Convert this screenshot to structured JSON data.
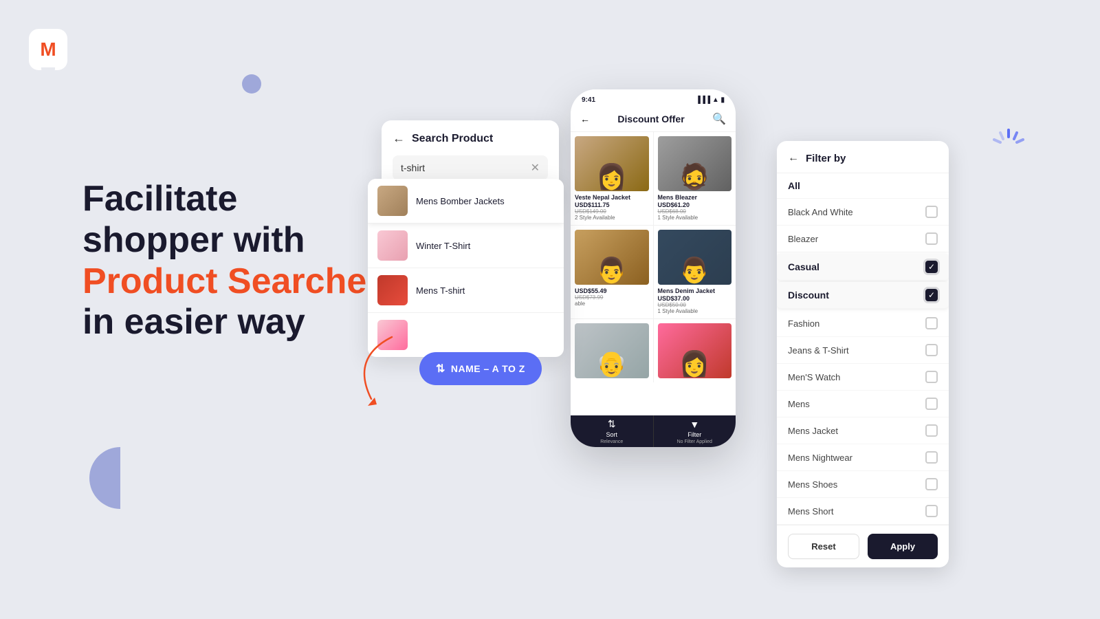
{
  "logo": {
    "letter": "M"
  },
  "hero": {
    "line1": "Facilitate",
    "line2": "shopper with",
    "highlight": "Product Searches",
    "line3": "in easier way"
  },
  "sort_badge": {
    "label": "NAME – A TO Z"
  },
  "search_panel": {
    "back_icon": "←",
    "title": "Search Product",
    "input_value": "t-shirt",
    "clear_icon": "✕"
  },
  "search_results": [
    {
      "name": "Mens Bomber Jackets",
      "img_class": "product-img-bomber"
    },
    {
      "name": "Winter T-Shirt",
      "img_class": "product-img-winter"
    },
    {
      "name": "Mens T-shirt",
      "img_class": "product-img-mens"
    },
    {
      "name": "",
      "img_class": "product-img-extra"
    }
  ],
  "phone": {
    "status_time": "9:41",
    "header_title": "Discount Offer",
    "products": [
      {
        "name": "Veste Nepal Jacket",
        "price_new": "USD$111.75",
        "price_old": "USD$149.00",
        "availability": "2 Style Available",
        "img_class": "img-veste"
      },
      {
        "name": "Mens Bleazer",
        "price_new": "USD$61.20",
        "price_old": "USD$68.00",
        "availability": "1 Style Available",
        "img_class": "img-bleazer"
      },
      {
        "name": "",
        "price_new": "USD$55.49",
        "price_old": "USD$73.99",
        "availability": "able",
        "img_class": "img-jacket-tan"
      },
      {
        "name": "Mens Denim Jacket",
        "price_new": "USD$37.00",
        "price_old": "USD$50.00",
        "availability": "1 Style Available",
        "img_class": "img-denim"
      },
      {
        "name": "",
        "price_new": "",
        "price_old": "",
        "availability": "",
        "img_class": "img-extra1"
      },
      {
        "name": "",
        "price_new": "",
        "price_old": "",
        "availability": "",
        "img_class": "img-pink"
      }
    ],
    "bottom_sort_label": "Sort",
    "bottom_sort_sub": "Relevance",
    "bottom_filter_label": "Filter",
    "bottom_filter_sub": "No Filter Applied"
  },
  "filter": {
    "back_icon": "←",
    "title": "Filter by",
    "items": [
      {
        "label": "All",
        "checked": false,
        "type": "all"
      },
      {
        "label": "Black And White",
        "checked": false
      },
      {
        "label": "Bleazer",
        "checked": false
      },
      {
        "label": "Casual",
        "checked": true
      },
      {
        "label": "Discount",
        "checked": true
      },
      {
        "label": "Fashion",
        "checked": false
      },
      {
        "label": "Jeans & T-Shirt",
        "checked": false
      },
      {
        "label": "Men'S Watch",
        "checked": false
      },
      {
        "label": "Mens",
        "checked": false
      },
      {
        "label": "Mens Jacket",
        "checked": false
      },
      {
        "label": "Mens Nightwear",
        "checked": false
      },
      {
        "label": "Mens Shoes",
        "checked": false
      },
      {
        "label": "Mens Short",
        "checked": false
      }
    ],
    "reset_label": "Reset",
    "apply_label": "Apply"
  }
}
